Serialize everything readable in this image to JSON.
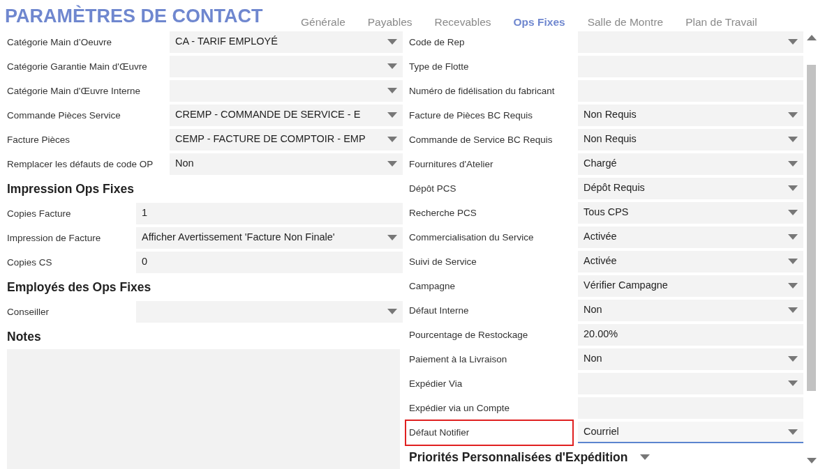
{
  "title": "PARAMÈTRES DE CONTACT",
  "tabs": [
    {
      "label": "Générale",
      "selected": false
    },
    {
      "label": "Payables",
      "selected": false
    },
    {
      "label": "Recevables",
      "selected": false
    },
    {
      "label": "Ops Fixes",
      "selected": true
    },
    {
      "label": "Salle de Montre",
      "selected": false
    },
    {
      "label": "Plan de Travail",
      "selected": false
    }
  ],
  "left_fields": [
    {
      "label": "Catégorie Main d’Oeuvre",
      "kind": "select",
      "value": "CA - TARIF EMPLOYÉ"
    },
    {
      "label": "Catégorie Garantie Main d'Œuvre",
      "kind": "select"
    },
    {
      "label": "Catégorie Main d'Œuvre Interne",
      "kind": "select"
    },
    {
      "label": "Commande Pièces Service",
      "kind": "select",
      "value": "CREMP - COMMANDE DE SERVICE - E"
    },
    {
      "label": "Facture Pièces",
      "kind": "select",
      "value": "CEMP - FACTURE DE COMPTOIR - EMP"
    },
    {
      "label": "Remplacer les défauts de code OP",
      "kind": "select",
      "value": "Non"
    }
  ],
  "invoice_print": {
    "heading": "Impression Ops Fixes",
    "fields": [
      {
        "label": "Copies Facture",
        "kind": "text",
        "value": "1"
      },
      {
        "label": "Impression de Facture",
        "kind": "select",
        "value": "Afficher Avertissement 'Facture Non Finale'"
      },
      {
        "label": "Copies CS",
        "kind": "text",
        "value": "0"
      }
    ]
  },
  "employees": {
    "heading": "Employés des Ops Fixes",
    "fields": [
      {
        "label": "Conseiller",
        "kind": "select"
      }
    ]
  },
  "notes": {
    "heading": "Notes"
  },
  "right_fields": [
    {
      "label": "Code de Rep",
      "kind": "select",
      "highlighted": false,
      "focused": false
    },
    {
      "label": "Type de Flotte",
      "kind": "text",
      "highlighted": false,
      "focused": false
    },
    {
      "label": "Numéro de fidélisation du fabricant",
      "kind": "text",
      "highlighted": false,
      "focused": false
    },
    {
      "label": "Facture de Pièces BC Requis",
      "kind": "select",
      "value": "Non Requis",
      "highlighted": false,
      "focused": false
    },
    {
      "label": "Commande de Service BC Requis",
      "kind": "select",
      "value": "Non Requis",
      "highlighted": false,
      "focused": false
    },
    {
      "label": "Fournitures d'Atelier",
      "kind": "select",
      "value": "Chargé",
      "highlighted": false,
      "focused": false
    },
    {
      "label": "Dépôt PCS",
      "kind": "select",
      "value": "Dépôt Requis",
      "highlighted": false,
      "focused": false
    },
    {
      "label": "Recherche PCS",
      "kind": "select",
      "value": "Tous CPS",
      "highlighted": false,
      "focused": false
    },
    {
      "label": "Commercialisation du Service",
      "kind": "select",
      "value": "Activée",
      "highlighted": false,
      "focused": false
    },
    {
      "label": "Suivi de Service",
      "kind": "select",
      "value": "Activée",
      "highlighted": false,
      "focused": false
    },
    {
      "label": "Campagne",
      "kind": "select",
      "value": "Vérifier Campagne",
      "highlighted": false,
      "focused": false
    },
    {
      "label": "Défaut Interne",
      "kind": "select",
      "value": "Non",
      "highlighted": false,
      "focused": false
    },
    {
      "label": "Pourcentage de Restockage",
      "kind": "text",
      "value": "20.00%",
      "highlighted": false,
      "focused": false
    },
    {
      "label": "Paiement à la Livraison",
      "kind": "select",
      "value": "Non",
      "highlighted": false,
      "focused": false
    },
    {
      "label": "Expédier Via",
      "kind": "select",
      "highlighted": false,
      "focused": false
    },
    {
      "label": "Expédier via un Compte",
      "kind": "text",
      "highlighted": false,
      "focused": false
    },
    {
      "label": "Défaut Notifier",
      "kind": "select",
      "value": "Courriel",
      "highlighted": true,
      "focused": true
    }
  ],
  "shipping_priorities": {
    "heading": "Priorités Personnalisées d'Expédition"
  }
}
